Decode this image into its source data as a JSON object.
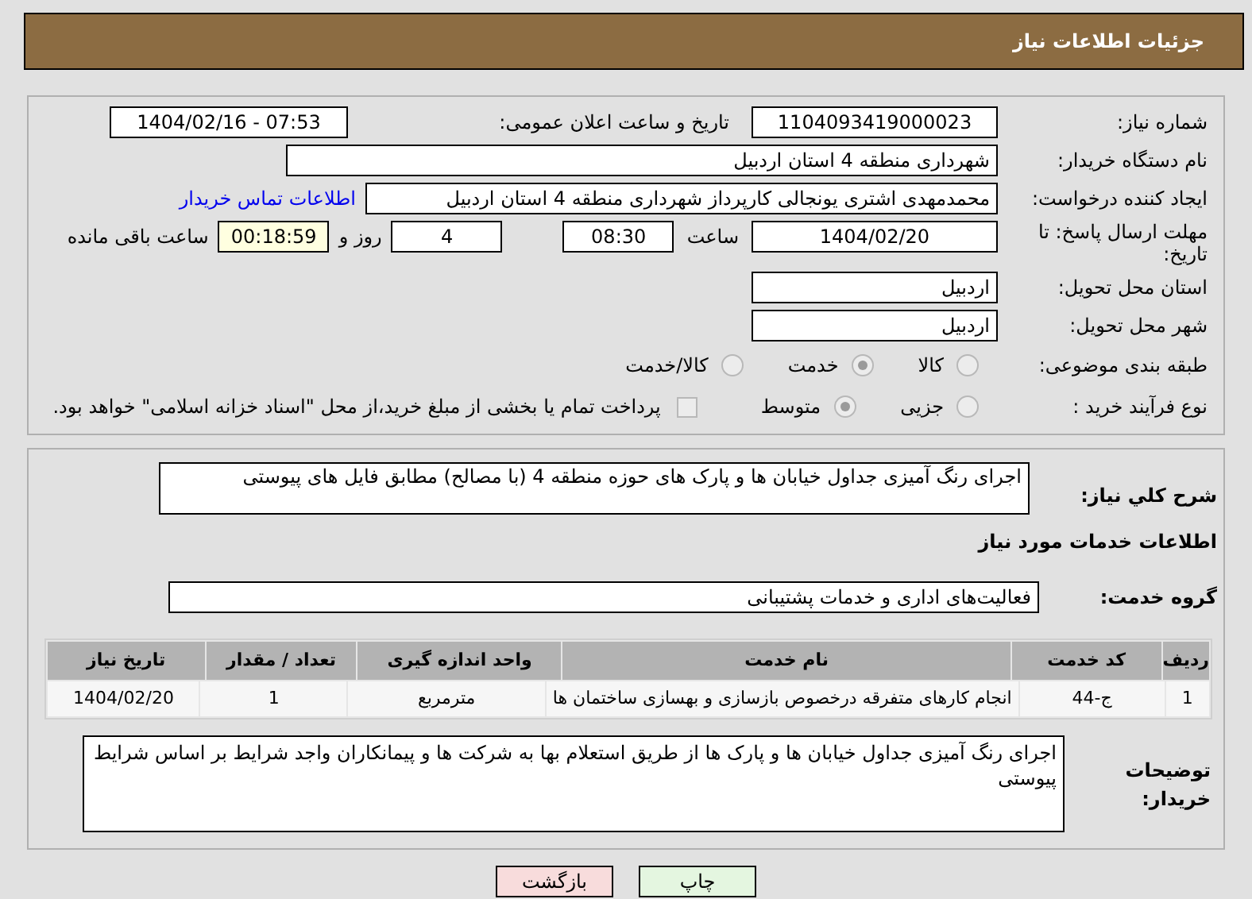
{
  "header": {
    "title": "جزئیات اطلاعات نیاز"
  },
  "need_number": {
    "label": "شماره نیاز:",
    "value": "1104093419000023"
  },
  "announce_datetime": {
    "label": "تاریخ و ساعت اعلان عمومی:",
    "value": "1404/02/16 - 07:53"
  },
  "buyer_org": {
    "label": "نام دستگاه خریدار:",
    "value": "شهرداری منطقه 4 استان اردبیل"
  },
  "requester": {
    "label": "ایجاد کننده درخواست:",
    "value": "محمدمهدی اشتری یونجالی کارپرداز شهرداری منطقه 4 استان اردبیل",
    "contact_link": "اطلاعات تماس خریدار"
  },
  "deadline": {
    "label": "مهلت ارسال پاسخ: تا تاریخ:",
    "date": "1404/02/20",
    "time_label": "ساعت",
    "time": "08:30",
    "days": "4",
    "days_label": "روز و",
    "remaining": "00:18:59",
    "remaining_label": "ساعت باقی مانده"
  },
  "province": {
    "label": "استان محل تحویل:",
    "value": "اردبیل"
  },
  "city": {
    "label": "شهر محل تحویل:",
    "value": "اردبیل"
  },
  "category": {
    "label": "طبقه بندی موضوعی:",
    "options": [
      {
        "label": "کالا",
        "selected": false
      },
      {
        "label": "خدمت",
        "selected": true
      },
      {
        "label": "کالا/خدمت",
        "selected": false
      }
    ]
  },
  "process": {
    "label": "نوع فرآیند خرید :",
    "options": [
      {
        "label": "جزیی",
        "selected": false
      },
      {
        "label": "متوسط",
        "selected": true
      }
    ],
    "payment_note": {
      "checked": false,
      "text": "پرداخت تمام یا بخشی از مبلغ خرید،از محل \"اسناد خزانه اسلامی\" خواهد بود."
    }
  },
  "description": {
    "label": "شرح کلي نياز:",
    "value": "اجرای رنگ آمیزی جداول خیابان ها و پارک های حوزه منطقه 4 (با مصالح) مطابق فایل های پیوستی"
  },
  "services_heading": "اطلاعات خدمات مورد نياز",
  "service_group": {
    "label": "گروه خدمت:",
    "value": "فعالیت‌های اداری و خدمات پشتیبانی"
  },
  "table": {
    "columns": [
      "ردیف",
      "کد خدمت",
      "نام خدمت",
      "واحد اندازه گیری",
      "تعداد / مقدار",
      "تاریخ نیاز"
    ],
    "rows": [
      [
        "1",
        "ج-44",
        "انجام کارهای متفرقه درخصوص بازسازی و بهسازی ساختمان ها",
        "مترمربع",
        "1",
        "1404/02/20"
      ]
    ]
  },
  "buyer_notes": {
    "label": "توضیحات خریدار:",
    "value": "اجرای رنگ آمیزی جداول خیابان ها و پارک ها از طریق استعلام بها به شرکت ها و پیمانکاران واجد شرایط بر اساس شرایط پیوستی"
  },
  "buttons": [
    {
      "label": "چاپ",
      "kind": "print"
    },
    {
      "label": "بازگشت",
      "kind": "back"
    }
  ]
}
